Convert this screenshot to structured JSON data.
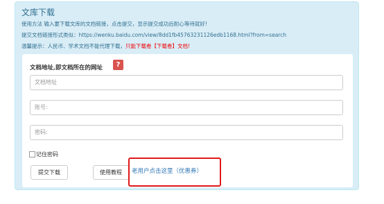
{
  "panel": {
    "title": "文库下载",
    "line1": "使用方法 输入要下载文库的文档链接，点击提交，显示提交成功后耐心等待就好!",
    "line2": "提交文档链接形式类似：https://wenku.baidu.com/view/8dd1fb45763231126edb1168.html?from=search",
    "line3_prefix": "温馨提示：人民币、学术文档不能代理下载，",
    "line3_warn": "只能下载卷【下载卷】文档!"
  },
  "form": {
    "doc_label": "文档地址,即文档所在的网址",
    "help_icon": "?",
    "doc_placeholder": "文档地址",
    "account_placeholder": "账号:",
    "password_placeholder": "密码:",
    "remember_label": "记住密码",
    "submit_label": "提交下载",
    "tutorial_label": "使用教程",
    "old_user_link": "老用户点击这里（优惠券）"
  },
  "colors": {
    "panel_bg": "#d9edf7",
    "panel_text": "#31708f",
    "warn": "#ee0000",
    "help_bg": "#d9534f",
    "highlight_border": "#e01818",
    "link": "#337ab7"
  }
}
